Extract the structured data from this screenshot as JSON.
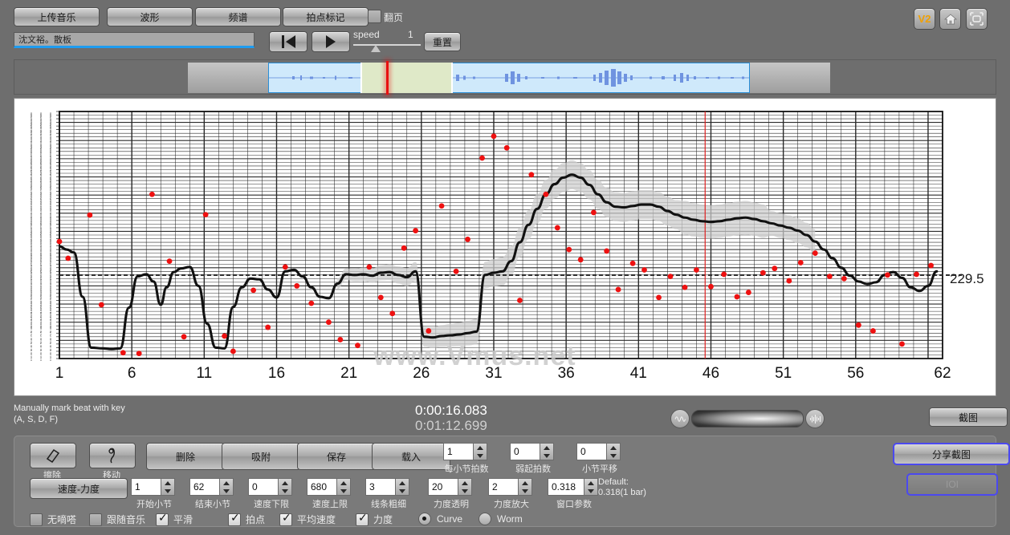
{
  "toolbar": {
    "buttons": [
      {
        "id": "upload",
        "label": "上传音乐"
      },
      {
        "id": "waveform",
        "label": "波形"
      },
      {
        "id": "spectrum",
        "label": "频谱"
      },
      {
        "id": "beatmark",
        "label": "拍点标记"
      }
    ],
    "flip_label": "翻页",
    "title_value": "沈文裕。散板",
    "speed_label": "speed",
    "speed_value": "1",
    "reset_label": "重置",
    "icons": [
      {
        "id": "v2",
        "label": "V2",
        "name": "v2-badge-icon"
      },
      {
        "id": "home",
        "label": "",
        "name": "home-icon"
      },
      {
        "id": "fullscreen",
        "label": "",
        "name": "fullscreen-icon"
      }
    ]
  },
  "status": {
    "hint_line1": "Manually mark beat with key",
    "hint_line2": "(A, S, D, F)",
    "time_current": "0:00:16.083",
    "time_total": "0:01:12.699",
    "screenshot_label": "截图"
  },
  "chart_data": {
    "type": "line",
    "title": "",
    "xlabel": "",
    "ylabel": "",
    "watermark": "www.Vmus.net",
    "right_value_label": "229.5",
    "grid": true,
    "legend_position": "none",
    "xlim": [
      1,
      62
    ],
    "ylim": [
      0,
      680
    ],
    "xticks": [
      1,
      6,
      11,
      16,
      21,
      26,
      31,
      36,
      41,
      46,
      51,
      56,
      62
    ],
    "reference_line": {
      "value": 229.5,
      "style": "dashed"
    },
    "playhead_x": 45.6,
    "series": [
      {
        "name": "tempo-curve",
        "type": "line",
        "color": "#111111",
        "x": [
          1.0,
          1.5,
          2.0,
          2.6,
          3.2,
          4.0,
          4.6,
          5.2,
          5.8,
          6.4,
          7.0,
          7.5,
          8.0,
          8.4,
          8.9,
          9.4,
          10.0,
          10.6,
          11.2,
          11.8,
          12.4,
          13.0,
          13.6,
          14.2,
          14.8,
          15.4,
          16.0,
          16.6,
          17.2,
          17.8,
          18.4,
          19.0,
          19.6,
          20.2,
          20.8,
          21.4,
          22.0,
          22.6,
          23.2,
          23.8,
          24.4,
          25.0,
          25.6,
          26.2,
          26.8,
          27.4,
          28.0,
          28.6,
          29.2,
          29.8,
          30.4,
          31.0,
          31.6,
          32.2,
          32.8,
          33.4,
          34.0,
          34.6,
          35.2,
          35.8,
          36.4,
          37.0,
          37.6,
          38.2,
          38.8,
          39.4,
          40.0,
          40.6,
          41.2,
          41.8,
          42.4,
          43.0,
          43.6,
          44.2,
          44.8,
          45.4,
          46.0,
          46.6,
          47.2,
          47.8,
          48.4,
          49.0,
          49.6,
          50.2,
          50.8,
          51.4,
          52.0,
          52.6,
          53.2,
          53.8,
          54.4,
          55.0,
          55.6,
          56.2,
          56.8,
          57.4,
          58.0,
          58.6,
          59.2,
          59.8,
          60.4,
          61.0,
          61.6
        ],
        "y": [
          309,
          300,
          292,
          170,
          30,
          28,
          26,
          28,
          140,
          226,
          232,
          212,
          148,
          196,
          238,
          248,
          252,
          200,
          96,
          30,
          28,
          142,
          196,
          220,
          218,
          190,
          168,
          240,
          244,
          226,
          196,
          170,
          166,
          206,
          232,
          230,
          232,
          228,
          236,
          238,
          230,
          224,
          240,
          60,
          58,
          62,
          64,
          66,
          70,
          74,
          230,
          236,
          240,
          268,
          320,
          368,
          412,
          452,
          480,
          498,
          506,
          498,
          478,
          452,
          430,
          418,
          416,
          420,
          424,
          424,
          418,
          406,
          396,
          388,
          382,
          378,
          376,
          378,
          382,
          386,
          388,
          384,
          378,
          372,
          366,
          360,
          352,
          340,
          322,
          300,
          276,
          250,
          228,
          212,
          205,
          210,
          230,
          238,
          222,
          196,
          186,
          200,
          240
        ]
      },
      {
        "name": "tempo-confidence-band",
        "type": "band",
        "color": "#cfcfcf"
      },
      {
        "name": "beat-points",
        "type": "scatter",
        "color": "#ee1111",
        "x": [
          1.0,
          1.6,
          3.1,
          3.9,
          5.4,
          6.5,
          7.4,
          8.6,
          9.6,
          11.1,
          12.4,
          13.0,
          14.4,
          15.4,
          16.6,
          17.4,
          18.4,
          19.6,
          20.4,
          21.6,
          22.4,
          23.2,
          24.0,
          24.8,
          25.6,
          26.5,
          27.4,
          28.4,
          29.2,
          30.2,
          31.0,
          31.9,
          32.8,
          33.6,
          34.6,
          35.4,
          36.2,
          37.0,
          37.9,
          38.8,
          39.6,
          40.6,
          41.4,
          42.4,
          43.2,
          44.2,
          45.0,
          46.0,
          46.9,
          47.8,
          48.6,
          49.6,
          50.4,
          51.4,
          52.2,
          53.2,
          54.2,
          55.2,
          56.2,
          57.2,
          58.2,
          59.2,
          60.2,
          61.2
        ],
        "y": [
          322,
          276,
          395,
          148,
          16,
          14,
          452,
          268,
          60,
          396,
          62,
          20,
          188,
          86,
          252,
          200,
          152,
          100,
          52,
          36,
          252,
          168,
          124,
          304,
          352,
          76,
          420,
          240,
          328,
          552,
          612,
          580,
          160,
          506,
          452,
          360,
          300,
          272,
          402,
          296,
          190,
          262,
          244,
          168,
          226,
          196,
          244,
          198,
          232,
          170,
          182,
          236,
          248,
          214,
          264,
          290,
          226,
          220,
          92,
          76,
          230,
          40,
          232,
          256
        ]
      }
    ]
  },
  "panel": {
    "erase_label": "擦除",
    "move_label": "移动",
    "delete_label": "删除",
    "snap_label": "吸附",
    "save_label": "保存",
    "load_label": "载入",
    "velocity_label": "速度-力度",
    "spinners_top": [
      {
        "id": "beats_per_bar",
        "value": "1",
        "label": "每小节拍数"
      },
      {
        "id": "pickup_beats",
        "value": "0",
        "label": "弱起拍数"
      },
      {
        "id": "bar_shift",
        "value": "0",
        "label": "小节平移"
      }
    ],
    "spinners_bottom": [
      {
        "id": "start_bar",
        "value": "1",
        "label": "开始小节"
      },
      {
        "id": "end_bar",
        "value": "62",
        "label": "结束小节"
      },
      {
        "id": "tempo_min",
        "value": "0",
        "label": "速度下限"
      },
      {
        "id": "tempo_max",
        "value": "680",
        "label": "速度上限"
      },
      {
        "id": "line_width",
        "value": "3",
        "label": "线条粗细"
      },
      {
        "id": "velocity_alpha",
        "value": "20",
        "label": "力度透明"
      },
      {
        "id": "velocity_zoom",
        "value": "2",
        "label": "力度放大"
      },
      {
        "id": "window_param",
        "value": "0.318",
        "label": "窗口参数"
      }
    ],
    "default_note_line1": "Default:",
    "default_note_line2": "0.318(1 bar)",
    "checkboxes": [
      {
        "id": "no_tick",
        "label": "无嘀嗒",
        "checked": false
      },
      {
        "id": "follow_music",
        "label": "跟随音乐",
        "checked": false
      },
      {
        "id": "smooth",
        "label": "平滑",
        "checked": true
      },
      {
        "id": "beats",
        "label": "拍点",
        "checked": true
      },
      {
        "id": "avg_tempo",
        "label": "平均速度",
        "checked": true
      },
      {
        "id": "velocity",
        "label": "力度",
        "checked": true
      }
    ],
    "radios": [
      {
        "id": "curve",
        "label": "Curve",
        "selected": true
      },
      {
        "id": "worm",
        "label": "Worm",
        "selected": false
      }
    ],
    "share_label": "分享截图",
    "ioi_label": "IOI"
  }
}
